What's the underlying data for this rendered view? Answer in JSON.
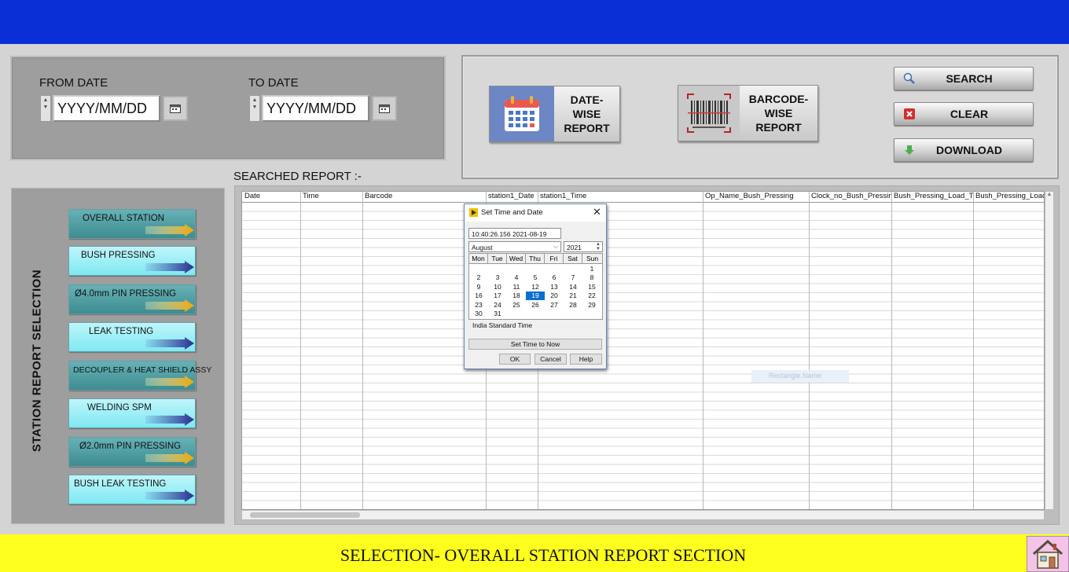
{
  "date_panel": {
    "from_label": "FROM DATE",
    "from_placeholder": "YYYY/MM/DD",
    "to_label": "TO DATE",
    "to_placeholder": "YYYY/MM/DD"
  },
  "report_buttons": {
    "date_wise_line1": "DATE-WISE",
    "date_wise_line2": "REPORT",
    "barcode_wise_line1": "BARCODE-WISE",
    "barcode_wise_line2": "REPORT"
  },
  "actions": {
    "search": "SEARCH",
    "clear": "CLEAR",
    "download": "DOWNLOAD"
  },
  "station_panel": {
    "title": "STATION REPORT SELECTION",
    "items": [
      {
        "label": "OVERALL STATION"
      },
      {
        "label": "BUSH PRESSING"
      },
      {
        "label": "Ø4.0mm PIN PRESSING"
      },
      {
        "label": "LEAK TESTING"
      },
      {
        "label": "DECOUPLER & HEAT SHIELD ASSY"
      },
      {
        "label": "WELDING SPM"
      },
      {
        "label": "Ø2.0mm PIN PRESSING"
      },
      {
        "label": "BUSH LEAK TESTING"
      }
    ]
  },
  "report": {
    "label": "SEARCHED REPORT :-",
    "columns": [
      "Date",
      "Time",
      "Barcode",
      "station1_Date",
      "station1_Time",
      "Op_Name_Bush_Pressing",
      "Clock_no_Bush_Pressing",
      "Bush_Pressing_Load_Top",
      "Bush_Pressing_Load_M"
    ],
    "hint": "Rectangle.Name"
  },
  "dialog": {
    "title": "Set Time and Date",
    "datetime_value": "10:40:26.156 2021-08-19",
    "month": "August",
    "year": "2021",
    "day_headers": [
      "Mon",
      "Tue",
      "Wed",
      "Thu",
      "Fri",
      "Sat",
      "Sun"
    ],
    "weeks": [
      [
        "",
        "",
        "",
        "",
        "",
        "",
        "1"
      ],
      [
        "2",
        "3",
        "4",
        "5",
        "6",
        "7",
        "8"
      ],
      [
        "9",
        "10",
        "11",
        "12",
        "13",
        "14",
        "15"
      ],
      [
        "16",
        "17",
        "18",
        "19",
        "20",
        "21",
        "22"
      ],
      [
        "23",
        "24",
        "25",
        "26",
        "27",
        "28",
        "29"
      ],
      [
        "30",
        "31",
        "",
        "",
        "",
        "",
        ""
      ]
    ],
    "selected_day": "19",
    "timezone": "India Standard Time",
    "set_now": "Set Time to Now",
    "ok": "OK",
    "cancel": "Cancel",
    "help": "Help"
  },
  "footer": {
    "text": "SELECTION- OVERALL STATION REPORT SECTION"
  },
  "colors": {
    "top_bar": "#0b2fd6",
    "footer_bar": "#ffff1e",
    "selected_day": "#0c6fcf"
  }
}
